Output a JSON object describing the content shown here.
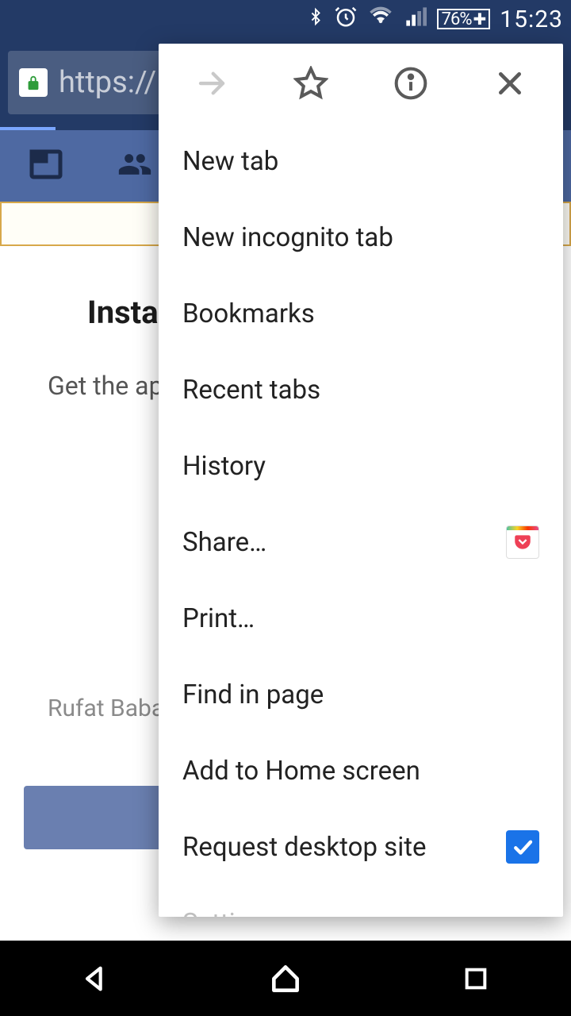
{
  "status": {
    "battery": "76%",
    "time": "15:23"
  },
  "browser": {
    "url_prefix": "https://"
  },
  "page": {
    "title_partial": "Instal",
    "subtitle_partial": "Get the app",
    "username_partial": "Rufat Babaye"
  },
  "menu": {
    "items": [
      {
        "label": "New tab"
      },
      {
        "label": "New incognito tab"
      },
      {
        "label": "Bookmarks"
      },
      {
        "label": "Recent tabs"
      },
      {
        "label": "History"
      },
      {
        "label": "Share…",
        "trailing": "pocket"
      },
      {
        "label": "Print…"
      },
      {
        "label": "Find in page"
      },
      {
        "label": "Add to Home screen"
      },
      {
        "label": "Request desktop site",
        "trailing": "checkbox_checked"
      }
    ],
    "cutoff_label": "Settings"
  }
}
